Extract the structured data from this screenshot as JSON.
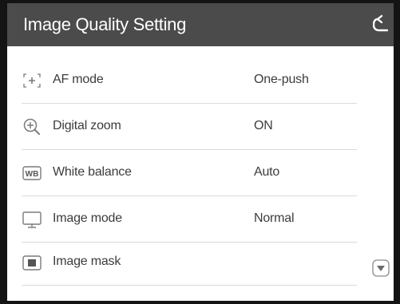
{
  "header": {
    "title": "Image Quality Setting",
    "back_icon": "return-arrow-icon",
    "background": "#4b4b4b",
    "text_color": "#ffffff"
  },
  "menu": {
    "items": [
      {
        "icon": "af-focus-icon",
        "label": "AF mode",
        "value": "One-push"
      },
      {
        "icon": "zoom-in-icon",
        "label": "Digital zoom",
        "value": "ON"
      },
      {
        "icon": "white-balance-icon",
        "label": "White balance",
        "value": "Auto"
      },
      {
        "icon": "monitor-icon",
        "label": "Image mode",
        "value": "Normal"
      },
      {
        "icon": "image-mask-icon",
        "label": "Image mask",
        "value": ""
      }
    ]
  },
  "scroll": {
    "down_icon": "scroll-down-icon"
  },
  "colors": {
    "frame": "#141414",
    "row_divider": "#d9d9d9",
    "text": "#3c3c3c",
    "icon": "#7a7a7a"
  }
}
